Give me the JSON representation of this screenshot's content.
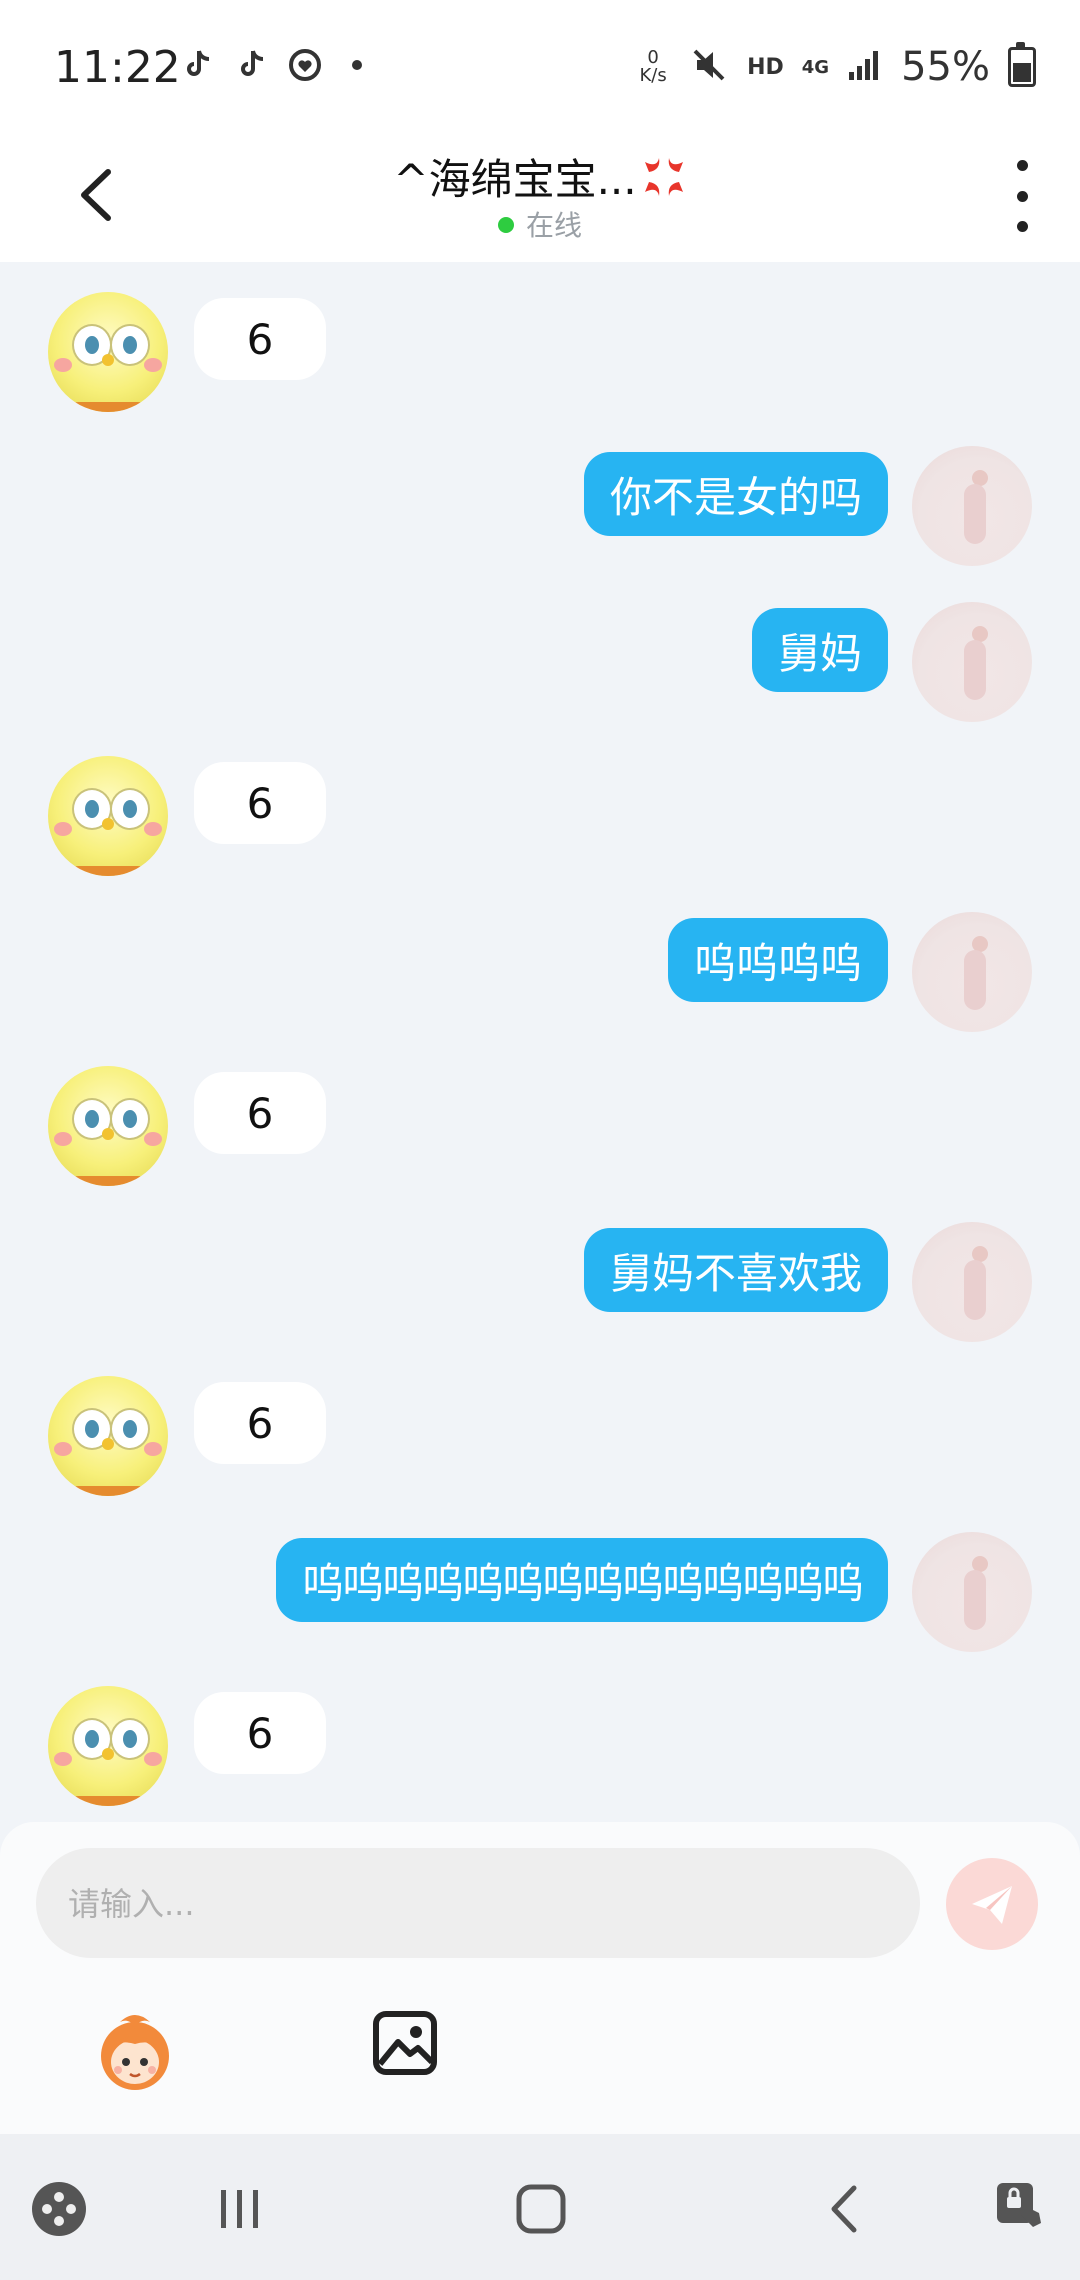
{
  "status_bar": {
    "time": "11:22",
    "net_speed_value": "0",
    "net_speed_unit": "K/s",
    "hd_label": "HD",
    "signal_label": "4G",
    "battery": "55%"
  },
  "header": {
    "title": "^海绵宝宝...",
    "status": "在线"
  },
  "messages": [
    {
      "side": "left",
      "text": "6"
    },
    {
      "side": "right",
      "text": "你不是女的吗"
    },
    {
      "side": "right",
      "text": "舅妈"
    },
    {
      "side": "left",
      "text": "6"
    },
    {
      "side": "right",
      "text": "呜呜呜呜"
    },
    {
      "side": "left",
      "text": "6"
    },
    {
      "side": "right",
      "text": "舅妈不喜欢我"
    },
    {
      "side": "left",
      "text": "6"
    },
    {
      "side": "right",
      "text": "呜呜呜呜呜呜呜呜呜呜呜呜呜呜"
    },
    {
      "side": "left",
      "text": "6"
    }
  ],
  "input": {
    "placeholder": "请输入..."
  },
  "colors": {
    "accent": "#27b4f2",
    "background": "#f1f4f8",
    "online": "#2ecc40",
    "send_button": "#fbd9d6"
  },
  "icons": {
    "back": "chevron-left-icon",
    "menu": "more-vertical-icon",
    "send": "paper-plane-icon",
    "emoji": "sticker-character-icon",
    "image": "image-icon"
  }
}
